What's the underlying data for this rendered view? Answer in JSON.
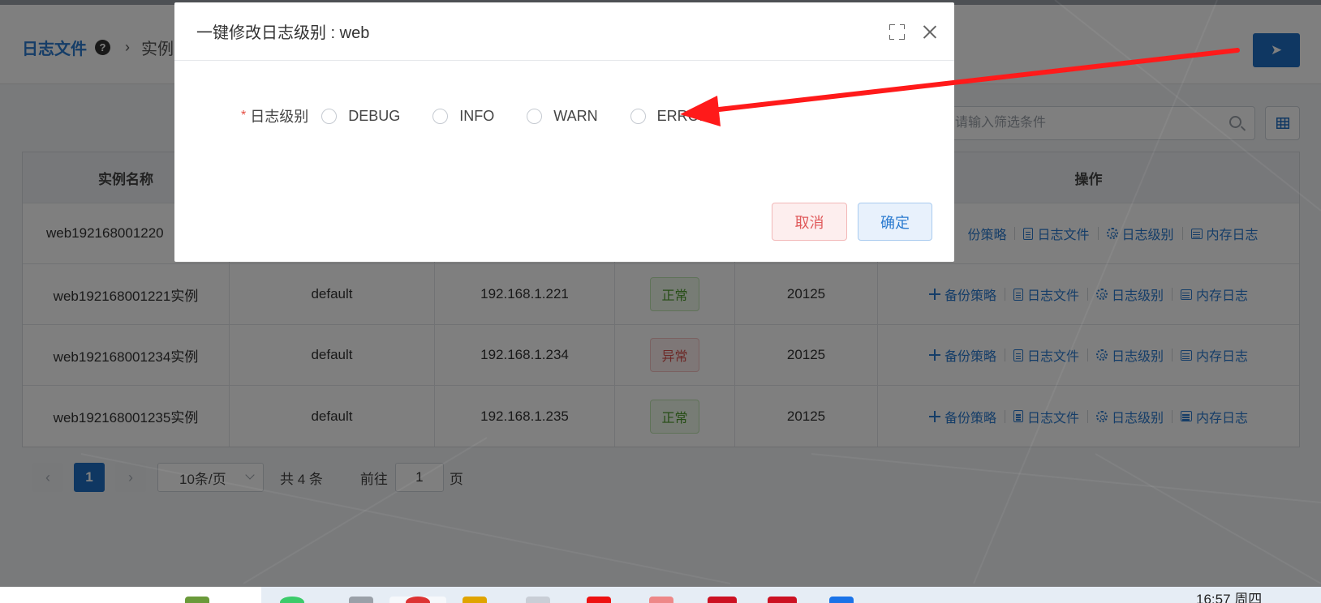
{
  "breadcrumb": {
    "main": "日志文件",
    "help": "?",
    "sep": "›",
    "sub": "实例"
  },
  "search": {
    "placeholder": "请输入筛选条件"
  },
  "table": {
    "headers": {
      "name": "实例名称",
      "actions": "操作"
    },
    "rows": [
      {
        "name": "web192168001220",
        "group": "",
        "ip": "",
        "status": "",
        "port": ""
      },
      {
        "name": "web192168001221实例",
        "group": "default",
        "ip": "192.168.1.221",
        "status": "正常",
        "port": "20125"
      },
      {
        "name": "web192168001234实例",
        "group": "default",
        "ip": "192.168.1.234",
        "status": "异常",
        "port": "20125"
      },
      {
        "name": "web192168001235实例",
        "group": "default",
        "ip": "192.168.1.235",
        "status": "正常",
        "port": "20125"
      }
    ],
    "actions": {
      "backup": "备份策略",
      "logfile": "日志文件",
      "loglevel": "日志级别",
      "memlog": "内存日志"
    },
    "partial_backup": "份策略"
  },
  "pager": {
    "prev": "‹",
    "page": "1",
    "next": "›",
    "page_size": "10条/页",
    "total": "共 4 条",
    "goto_prefix": "前往",
    "goto_value": "1",
    "goto_suffix": "页"
  },
  "dialog": {
    "title": "一键修改日志级别 : web",
    "field_required": "*",
    "field_label": "日志级别",
    "options": [
      "DEBUG",
      "INFO",
      "WARN",
      "ERROR"
    ],
    "cancel": "取消",
    "ok": "确定"
  },
  "taskbar": {
    "time": "16:57 周四"
  },
  "colors": {
    "primary": "#1f6fc5",
    "link": "#2b7bd0",
    "ok": "#4c9a2a",
    "error": "#d9534f",
    "arrow": "#ff1a1a"
  }
}
